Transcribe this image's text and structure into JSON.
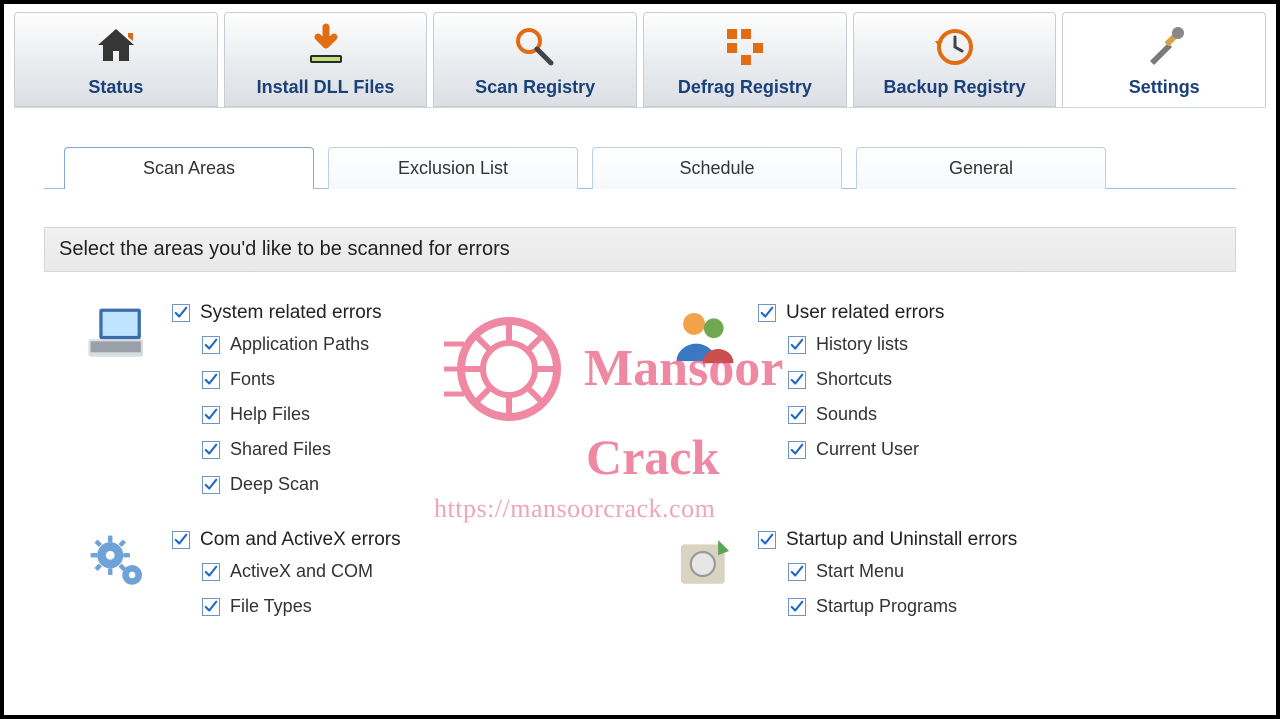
{
  "topnav": {
    "items": [
      {
        "key": "status",
        "label": "Status"
      },
      {
        "key": "install",
        "label": "Install DLL Files"
      },
      {
        "key": "scan",
        "label": "Scan Registry"
      },
      {
        "key": "defrag",
        "label": "Defrag Registry"
      },
      {
        "key": "backup",
        "label": "Backup Registry"
      },
      {
        "key": "settings",
        "label": "Settings"
      }
    ],
    "active": "settings"
  },
  "tabs": {
    "items": [
      {
        "key": "scanareas",
        "label": "Scan Areas"
      },
      {
        "key": "exclusion",
        "label": "Exclusion List"
      },
      {
        "key": "schedule",
        "label": "Schedule"
      },
      {
        "key": "general",
        "label": "General"
      }
    ],
    "active": "scanareas"
  },
  "description": "Select the areas you'd like to be scanned for errors",
  "groups": [
    {
      "key": "system",
      "title": "System related errors",
      "checked": true,
      "items": [
        {
          "label": "Application Paths",
          "checked": true
        },
        {
          "label": "Fonts",
          "checked": true
        },
        {
          "label": "Help Files",
          "checked": true
        },
        {
          "label": "Shared Files",
          "checked": true
        },
        {
          "label": "Deep Scan",
          "checked": true
        }
      ]
    },
    {
      "key": "user",
      "title": "User related errors",
      "checked": true,
      "items": [
        {
          "label": "History lists",
          "checked": true
        },
        {
          "label": "Shortcuts",
          "checked": true
        },
        {
          "label": "Sounds",
          "checked": true
        },
        {
          "label": "Current User",
          "checked": true
        }
      ]
    },
    {
      "key": "com",
      "title": "Com and ActiveX errors",
      "checked": true,
      "items": [
        {
          "label": "ActiveX and COM",
          "checked": true
        },
        {
          "label": "File Types",
          "checked": true
        }
      ]
    },
    {
      "key": "startup",
      "title": "Startup and Uninstall errors",
      "checked": true,
      "items": [
        {
          "label": "Start Menu",
          "checked": true
        },
        {
          "label": "Startup Programs",
          "checked": true
        }
      ]
    }
  ],
  "watermark": {
    "word1": "Mansoor",
    "word2": "Crack",
    "url": "https://mansoorcrack.com"
  }
}
